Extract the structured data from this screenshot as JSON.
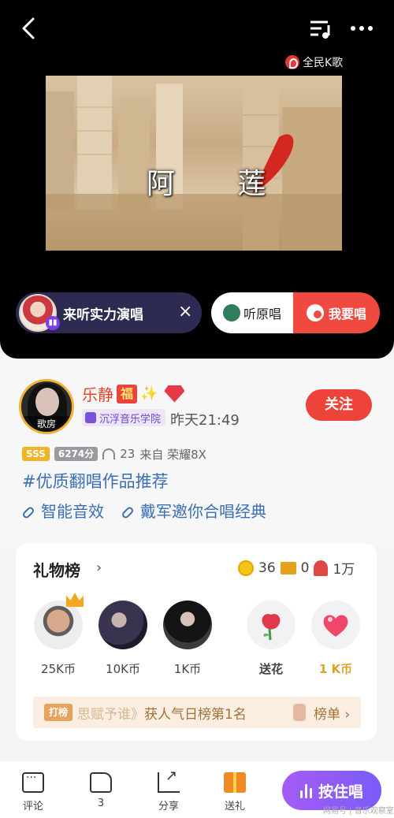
{
  "player": {
    "brand": "全民K歌",
    "video_title": "阿 莲"
  },
  "listen_pill": {
    "text": "来听实力演唱",
    "close": "×"
  },
  "sing_actions": {
    "original": "听原唱",
    "sing": "我要唱"
  },
  "profile": {
    "name": "乐静",
    "fu_badge": "福",
    "sparkle": "✨",
    "avatar_tag": "歌房",
    "school": "沉浮音乐学院",
    "time": "昨天21:49",
    "follow": "关注",
    "rank_tag": "SSS",
    "score": "6274分",
    "plays": "23",
    "device": "来自 荣耀8X",
    "hashtag": "#优质翻唱作品推荐",
    "links": [
      "智能音效",
      "戴军邀你合唱经典"
    ]
  },
  "gift_board": {
    "title": "礼物榜",
    "arrow": "›",
    "coins": "36",
    "boxes": "0",
    "flowers": "1万",
    "donors": [
      {
        "label": "25K币"
      },
      {
        "label": "10K币"
      },
      {
        "label": "1K币"
      }
    ],
    "gifts": [
      {
        "label": "送花"
      },
      {
        "label": "1 K币"
      }
    ],
    "banner_tag": "打榜",
    "banner_text_faded": "思赋予谁》",
    "banner_text": "获人气日榜第1名",
    "banner_link": "榜单 ›"
  },
  "bottom_bar": {
    "comment": "评论",
    "like": "3",
    "share": "分享",
    "gift": "送礼",
    "sing_now": "按住唱"
  },
  "watermark": "网易号 | 音乐观察室"
}
